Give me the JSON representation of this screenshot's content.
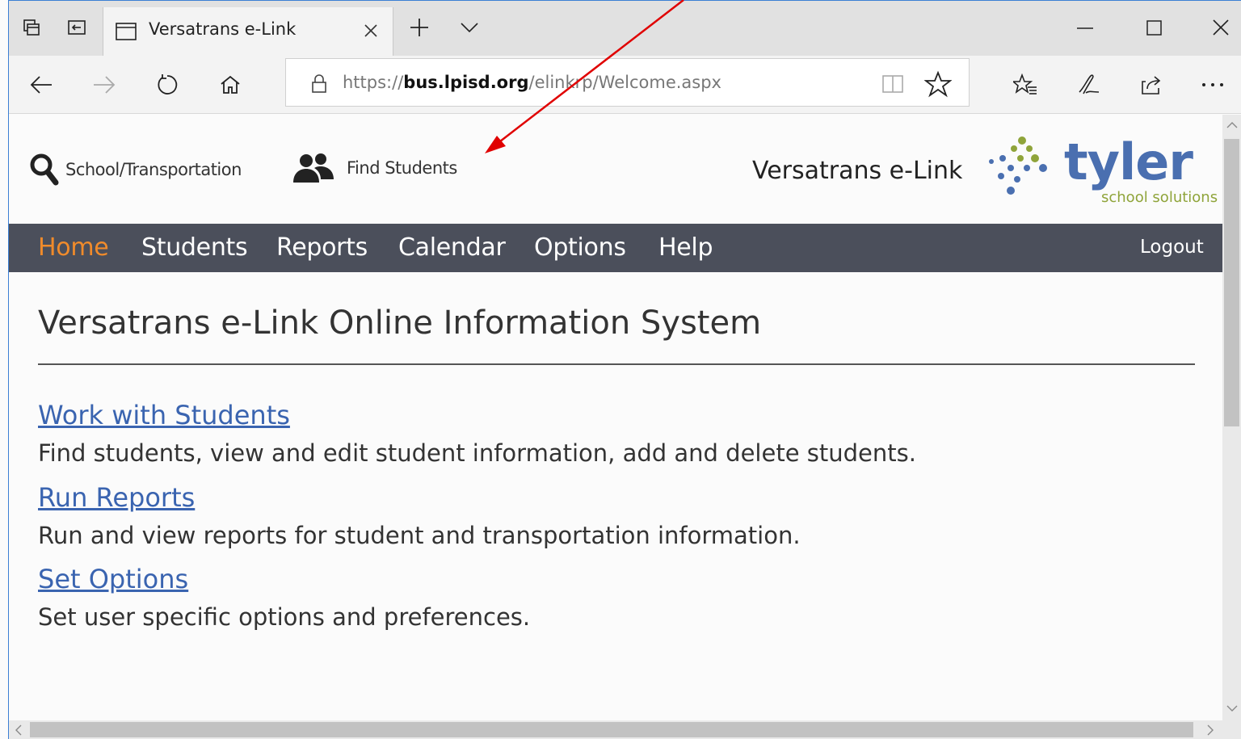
{
  "browser": {
    "tab_title": "Versatrans e-Link",
    "url_prefix": "https://",
    "url_host": "bus.lpisd.org",
    "url_path": "/elinkrp/Welcome.aspx"
  },
  "header": {
    "school_link": "School/Transportation",
    "find_students_link": "Find Students",
    "brand_title": "Versatrans e-Link",
    "logo_word": "tyler",
    "logo_sub": "school solutions"
  },
  "menu": {
    "items": [
      "Home",
      "Students",
      "Reports",
      "Calendar",
      "Options",
      "Help"
    ],
    "active": "Home",
    "logout": "Logout"
  },
  "main": {
    "title": "Versatrans e-Link Online Information System",
    "sections": [
      {
        "link": "Work with Students",
        "description": "Find students, view and edit student information, add and delete students."
      },
      {
        "link": "Run Reports",
        "description": "Run and view reports for student and transportation information."
      },
      {
        "link": "Set Options",
        "description": "Set user specific options and preferences."
      }
    ]
  },
  "colors": {
    "menu_bg": "#4b4f5b",
    "menu_active": "#f08b2b",
    "link": "#3a64b0",
    "logo_blue": "#4a6fb0",
    "logo_green": "#8fa43a",
    "annotation_arrow": "#e00000"
  }
}
